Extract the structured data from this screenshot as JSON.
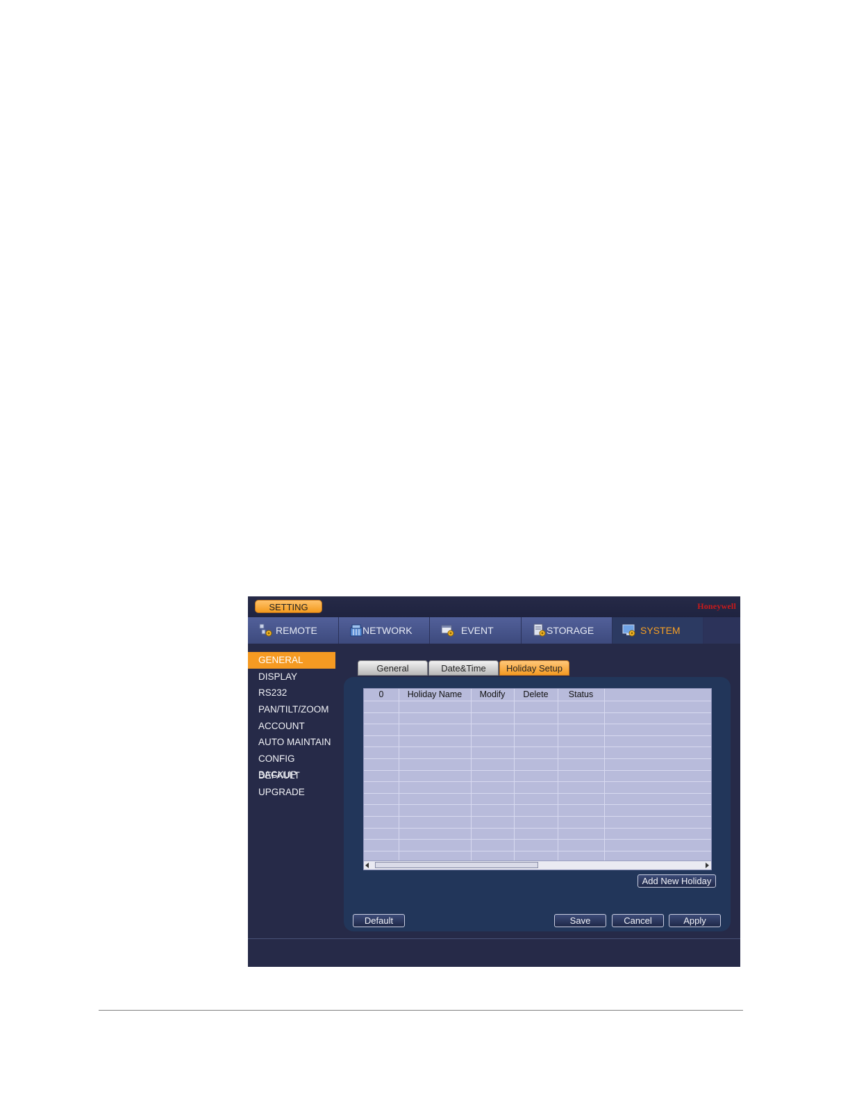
{
  "header": {
    "setting_label": "SETTING",
    "brand": "Honeywell"
  },
  "nav": {
    "tabs": [
      {
        "label": "REMOTE",
        "icon": "remote-icon"
      },
      {
        "label": "NETWORK",
        "icon": "network-icon"
      },
      {
        "label": "EVENT",
        "icon": "event-icon"
      },
      {
        "label": "STORAGE",
        "icon": "storage-icon"
      },
      {
        "label": "SYSTEM",
        "icon": "system-icon",
        "active": true
      }
    ]
  },
  "sidebar": {
    "items": [
      {
        "label": "GENERAL",
        "active": true
      },
      {
        "label": "DISPLAY"
      },
      {
        "label": "RS232"
      },
      {
        "label": "PAN/TILT/ZOOM"
      },
      {
        "label": "ACCOUNT"
      },
      {
        "label": "AUTO MAINTAIN"
      },
      {
        "label": "CONFIG BACKUP"
      },
      {
        "label": "DEFAULT"
      },
      {
        "label": "UPGRADE"
      }
    ]
  },
  "subtabs": [
    {
      "label": "General"
    },
    {
      "label": "Date&Time"
    },
    {
      "label": "Holiday Setup",
      "active": true
    }
  ],
  "holiday_table": {
    "columns": [
      "0",
      "Holiday Name",
      "Modify",
      "Delete",
      "Status"
    ],
    "rows": []
  },
  "buttons": {
    "add_new_holiday": "Add New Holiday",
    "default": "Default",
    "save": "Save",
    "cancel": "Cancel",
    "apply": "Apply"
  },
  "colors": {
    "accent": "#f59a22",
    "background": "#262a48",
    "brand": "#cc1a1a"
  }
}
